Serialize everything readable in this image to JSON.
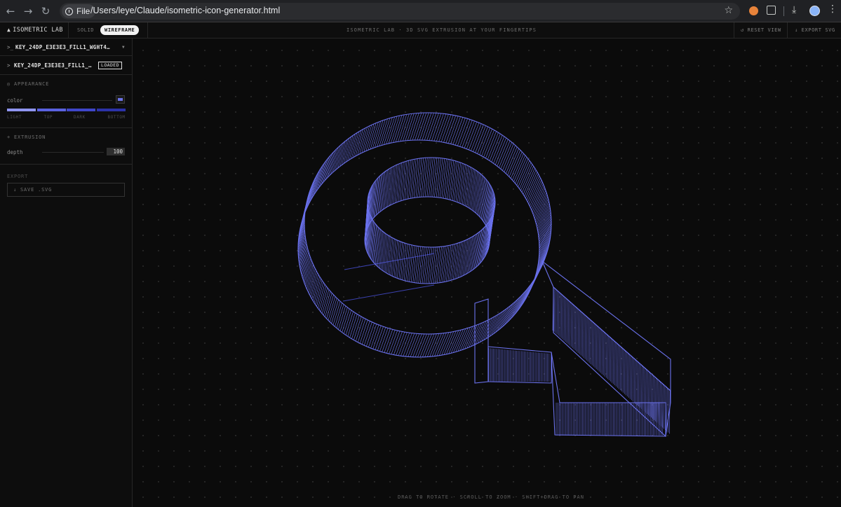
{
  "browser": {
    "file_chip": "File",
    "url": "/Users/leye/Claude/isometric-icon-generator.html"
  },
  "app": {
    "brand": "ISOMETRIC LAB",
    "modes": {
      "solid": "SOLID",
      "wireframe": "WIREFRAME"
    },
    "tagline": "ISOMETRIC LAB  ·  3D SVG EXTRUSION AT YOUR FINGERTIPS",
    "actions": {
      "reset": "↺ RESET VIEW",
      "export": "↓ EXPORT SVG"
    }
  },
  "sidebar": {
    "file_select": {
      "prefix": ">_",
      "name": "KEY_24DP_E3E3E3_FILL1_WGHT4…"
    },
    "loaded_file": {
      "prefix": ">",
      "name": "KEY_24DP_E3E3E3_FILL1_…",
      "badge": "LOADED"
    },
    "appearance": {
      "title": "◎ APPEARANCE",
      "color_label": "color",
      "color_value": "#6b72e8",
      "shades": [
        {
          "label": "LIGHT",
          "color": "#8f95f0"
        },
        {
          "label": "TOP",
          "color": "#5a62e0"
        },
        {
          "label": "DARK",
          "color": "#3f46c9"
        },
        {
          "label": "BOTTOM",
          "color": "#2c32a8"
        }
      ]
    },
    "extrusion": {
      "title": "+ EXTRUSION",
      "depth_label": "depth",
      "depth_value": "100"
    },
    "export": {
      "title": "EXPORT",
      "save_label": "↓ SAVE .SVG"
    }
  },
  "canvas": {
    "hint": "DRAG TO ROTATE  ·  SCROLL TO ZOOM  ·  SHIFT+DRAG TO PAN",
    "wire_color": "#6b72ee",
    "wire_back_color": "#3c42b0"
  }
}
